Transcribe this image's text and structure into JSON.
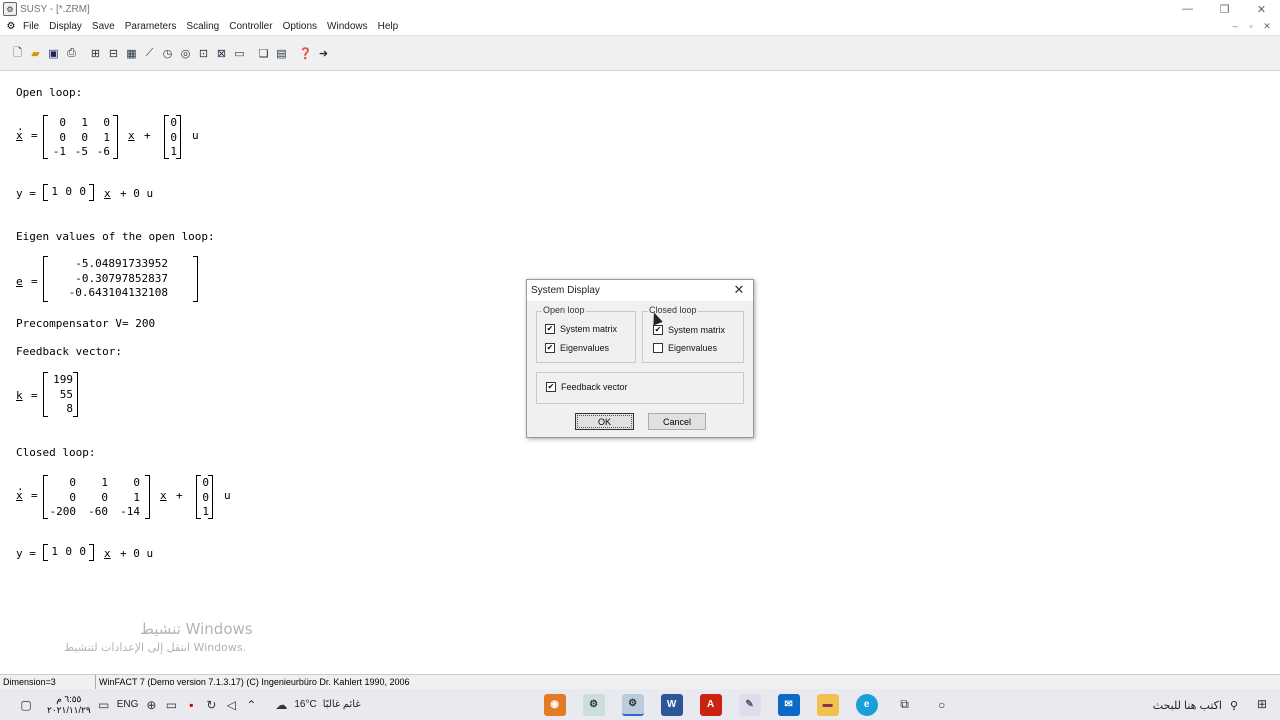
{
  "window": {
    "title": "SUSY - [*.ZRM]"
  },
  "menu": [
    "File",
    "Display",
    "Save",
    "Parameters",
    "Scaling",
    "Controller",
    "Options",
    "Windows",
    "Help"
  ],
  "content": {
    "open_loop_heading": "Open loop:",
    "open_loop_state_var": "x",
    "open_loop_A": [
      [
        "0",
        "1",
        "0"
      ],
      [
        "0",
        "0",
        "1"
      ],
      [
        "-1",
        "-5",
        "-6"
      ]
    ],
    "open_loop_B": [
      [
        "0"
      ],
      [
        "0"
      ],
      [
        "1"
      ]
    ],
    "open_loop_output_C": [
      [
        "1",
        "0",
        "0"
      ]
    ],
    "y_label": "y =",
    "x_var": "x",
    "plus_zero_u": "+ 0 u",
    "eigen_heading": "Eigen values of the open loop:",
    "eigen_var": "e",
    "eigen_values": [
      [
        "-5.04891733952"
      ],
      [
        "-0.30797852837"
      ],
      [
        "-0.643104132108"
      ]
    ],
    "precomp": "Precompensator V= 200",
    "feedback_heading": "Feedback vector:",
    "feedback_var": "k",
    "feedback_values": [
      [
        "199"
      ],
      [
        "55"
      ],
      [
        "8"
      ]
    ],
    "closed_loop_heading": "Closed loop:",
    "closed_loop_A": [
      [
        "0",
        "1",
        "0"
      ],
      [
        "0",
        "0",
        "1"
      ],
      [
        "-200",
        "-60",
        "-14"
      ]
    ],
    "closed_loop_B": [
      [
        "0"
      ],
      [
        "0"
      ],
      [
        "1"
      ]
    ],
    "closed_loop_output_C": [
      [
        "1",
        "0",
        "0"
      ]
    ]
  },
  "watermark": {
    "line1": "تنشيط Windows",
    "line2": "انتقل إلى الإعدادات لتنشيط Windows."
  },
  "status": {
    "dimension": "Dimension=3",
    "info": "WinFACT 7 (Demo version 7.1.3.17)  (C) Ingenieurbüro Dr. Kahlert 1990, 2006"
  },
  "taskbar": {
    "time": "٦:٥٥ م",
    "date": "٢٠٢١/١١/٢٩",
    "lang": "ENG",
    "weather": "16°C",
    "weather_text": "غائم غالبًا",
    "search": "اكتب هنا للبحث"
  },
  "dialog": {
    "title": "System Display",
    "open_loop_group": "Open loop",
    "closed_loop_group": "Closed loop",
    "open_system_matrix": "System matrix",
    "open_eigenvalues": "Eigenvalues",
    "closed_system_matrix": "System matrix",
    "closed_eigenvalues": "Eigenvalues",
    "feedback_vector": "Feedback vector",
    "ok": "OK",
    "cancel": "Cancel",
    "checked": {
      "open_system_matrix": true,
      "open_eigenvalues": true,
      "closed_system_matrix": true,
      "closed_eigenvalues": false,
      "feedback_vector": true
    }
  }
}
